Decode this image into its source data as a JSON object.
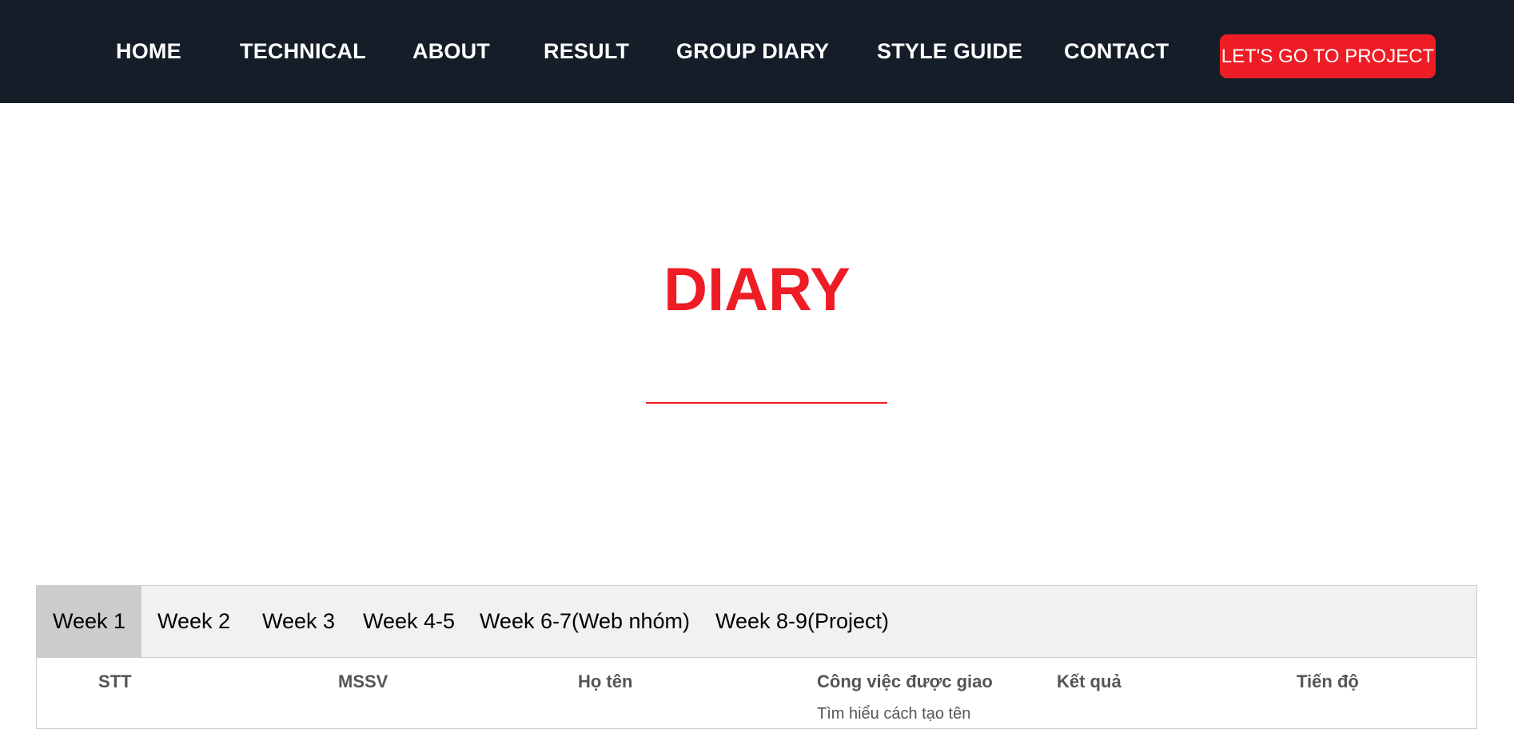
{
  "nav": {
    "items": [
      "HOME",
      "TECHNICAL",
      "ABOUT",
      "RESULT",
      "GROUP DIARY",
      "STYLE GUIDE",
      "CONTACT"
    ],
    "cta": "LET'S GO TO PROJECT"
  },
  "hero": {
    "title": "DIARY"
  },
  "tabs": [
    "Week 1",
    "Week 2",
    "Week 3",
    "Week 4-5",
    "Week 6-7(Web nhóm)",
    "Week 8-9(Project)"
  ],
  "table": {
    "headers": [
      "STT",
      "MSSV",
      "Họ tên",
      "Công việc được giao",
      "Kết quả",
      "Tiến độ"
    ],
    "first_row_task": "Tìm hiểu cách tạo tên"
  },
  "colors": {
    "nav_bg": "#151e28",
    "accent": "#ee1c25",
    "tab_bar_bg": "#f1f1f1",
    "tab_active_bg": "#cccccc"
  }
}
